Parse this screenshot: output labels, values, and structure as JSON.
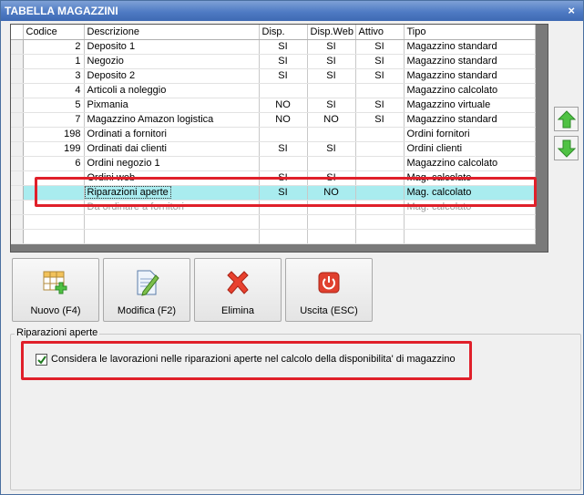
{
  "window": {
    "title": "TABELLA MAGAZZINI",
    "close_glyph": "×"
  },
  "grid": {
    "columns": [
      "Codice",
      "Descrizione",
      "Disp.",
      "Disp.Web",
      "Attivo",
      "Tipo"
    ],
    "rows": [
      {
        "codice": "2",
        "descrizione": "Deposito 1",
        "disp": "SI",
        "dispweb": "SI",
        "attivo": "SI",
        "tipo": "Magazzino standard"
      },
      {
        "codice": "1",
        "descrizione": "Negozio",
        "disp": "SI",
        "dispweb": "SI",
        "attivo": "SI",
        "tipo": "Magazzino standard"
      },
      {
        "codice": "3",
        "descrizione": "Deposito 2",
        "disp": "SI",
        "dispweb": "SI",
        "attivo": "SI",
        "tipo": "Magazzino standard"
      },
      {
        "codice": "4",
        "descrizione": "Articoli a noleggio",
        "disp": "",
        "dispweb": "",
        "attivo": "",
        "tipo": "Magazzino calcolato"
      },
      {
        "codice": "5",
        "descrizione": "Pixmania",
        "disp": "NO",
        "dispweb": "SI",
        "attivo": "SI",
        "tipo": "Magazzino virtuale"
      },
      {
        "codice": "7",
        "descrizione": "Magazzino Amazon logistica",
        "disp": "NO",
        "dispweb": "NO",
        "attivo": "SI",
        "tipo": "Magazzino standard"
      },
      {
        "codice": "198",
        "descrizione": "Ordinati a fornitori",
        "disp": "",
        "dispweb": "",
        "attivo": "",
        "tipo": "Ordini fornitori"
      },
      {
        "codice": "199",
        "descrizione": "Ordinati dai clienti",
        "disp": "SI",
        "dispweb": "SI",
        "attivo": "",
        "tipo": "Ordini clienti"
      },
      {
        "codice": "6",
        "descrizione": "Ordini negozio 1",
        "disp": "",
        "dispweb": "",
        "attivo": "",
        "tipo": "Magazzino calcolato"
      },
      {
        "codice": "",
        "descrizione": "Ordini web",
        "disp": "SI",
        "dispweb": "SI",
        "attivo": "",
        "tipo": "Mag. calcolato"
      },
      {
        "codice": "",
        "descrizione": "Riparazioni aperte",
        "disp": "SI",
        "dispweb": "NO",
        "attivo": "",
        "tipo": "Mag. calcolato"
      },
      {
        "codice": "",
        "descrizione": "Da ordinare a fornitori",
        "disp": "",
        "dispweb": "",
        "attivo": "",
        "tipo": "Mag. calcolato"
      }
    ],
    "selected_row_index": 10
  },
  "side_buttons": {
    "up_icon": "arrow-up-icon",
    "down_icon": "arrow-down-icon"
  },
  "toolbar": {
    "new_label": "Nuovo (F4)",
    "edit_label": "Modifica (F2)",
    "delete_label": "Elimina",
    "exit_label": "Uscita (ESC)"
  },
  "group": {
    "title": "Riparazioni aperte",
    "checkbox_label": "Considera le lavorazioni nelle riparazioni aperte nel calcolo della disponibilita' di magazzino",
    "checkbox_checked": true
  },
  "colors": {
    "accent_red": "#e0202a",
    "selection": "#a9ecef",
    "title_bar": "#4f7bc4"
  }
}
